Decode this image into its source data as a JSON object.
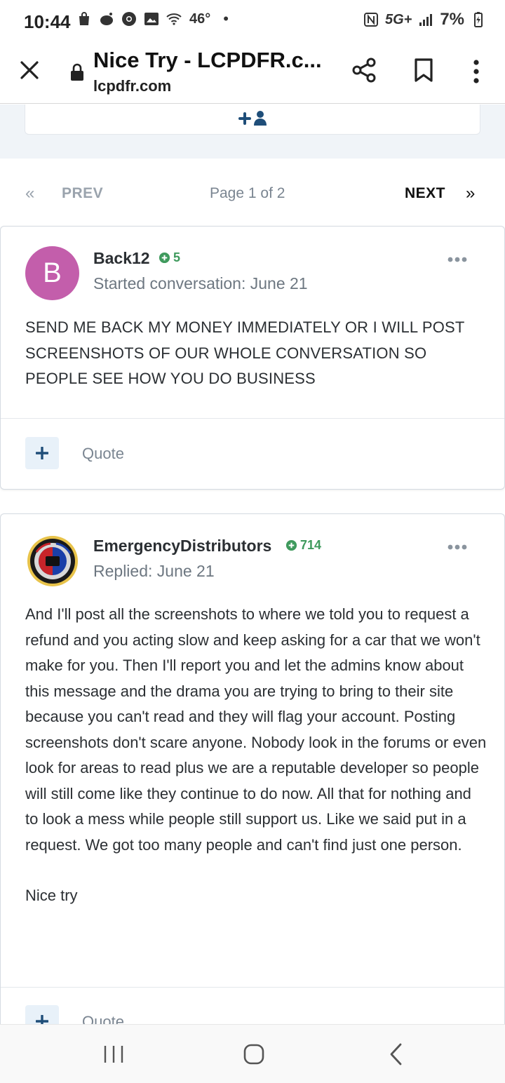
{
  "status_bar": {
    "time": "10:44",
    "temperature": "46°",
    "network": "5G+",
    "battery": "7%"
  },
  "toolbar": {
    "title": "Nice Try - LCPDFR.c...",
    "url": "lcpdfr.com"
  },
  "pagination": {
    "prev_label": "PREV",
    "page_info": "Page 1 of 2",
    "next_label": "NEXT",
    "prev_chevron": "«",
    "next_chevron": "»"
  },
  "posts": [
    {
      "avatar_letter": "B",
      "author": "Back12",
      "reputation": "5",
      "meta": "Started conversation: June 21",
      "body": "SEND ME BACK MY MONEY IMMEDIATELY OR I WILL POST SCREENSHOTS OF OUR WHOLE CONVERSATION SO PEOPLE SEE HOW YOU DO BUSINESS",
      "quote_label": "Quote"
    },
    {
      "author": "EmergencyDistributors",
      "reputation": "714",
      "meta": "Replied: June 21",
      "body_paragraphs": [
        "And I'll post all the screenshots to where we told you to request a refund and you acting slow and keep asking for a car that we won't make for you. Then I'll report you and let the admins know about this message and the drama you are trying to bring to their site because you can't read and they will flag your account. Posting screenshots don't scare anyone. Nobody look in the forums or even look for areas to read plus we are a reputable developer so people will still come like they continue to do now. All that for nothing and to look a mess while people still support us. Like we said put in a request.  We got too many people and can't find just one person.",
        "Nice try"
      ],
      "quote_label": "Quote"
    }
  ],
  "colors": {
    "accent": "#1f4e79",
    "reputation": "#3f9a5d",
    "avatar_bg": "#c35eab",
    "muted": "#7a8591"
  }
}
